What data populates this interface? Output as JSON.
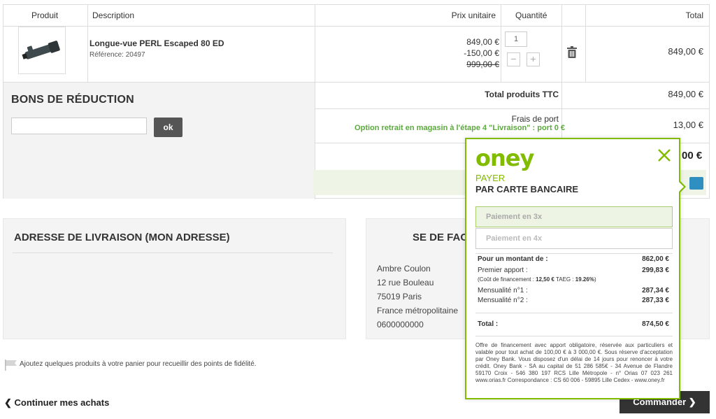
{
  "table": {
    "headers": {
      "produit": "Produit",
      "description": "Description",
      "prix_unitaire": "Prix unitaire",
      "quantite": "Quantité",
      "total": "Total"
    },
    "item": {
      "name": "Longue-vue PERL Escaped 80 ED",
      "reference": "Référence: 20497",
      "price": "849,00 €",
      "discount": "-150,00 €",
      "old_price": "999,00 €",
      "quantity": "1",
      "total": "849,00 €"
    }
  },
  "coupons": {
    "title": "BONS DE RÉDUCTION",
    "input_value": "",
    "ok_label": "ok"
  },
  "totals": {
    "products_label": "Total produits TTC",
    "products_value": "849,00 €",
    "shipping_label": "Frais de port",
    "shipping_note": "Option retrait en magasin à l'étape 4 \"Livraison\" : port 0 €",
    "shipping_value": "13,00 €",
    "grand_total_partial": "00 €"
  },
  "delivery": {
    "title": "ADRESSE DE LIVRAISON (MON ADRESSE)"
  },
  "billing": {
    "title_partial": "SE DE FAC",
    "lines": [
      "Ambre Coulon",
      "12 rue Bouleau",
      "75019 Paris",
      "France métropolitaine",
      "0600000000"
    ]
  },
  "loyalty_text": "Ajoutez quelques produits à votre panier pour recueillir des points de fidélité.",
  "continue_label": "Continuer mes achats",
  "order_label": "Commander",
  "oney": {
    "logo": "oney",
    "payer": "PAYER",
    "par_carte": "PAR CARTE BANCAIRE",
    "options": [
      "Paiement en 3x",
      "Paiement en 4x"
    ],
    "amount_label": "Pour un montant de :",
    "amount_value": "862,00 €",
    "first_label": "Premier apport :",
    "first_value": "299,83 €",
    "cost_note_prefix": "(Coût de financement : ",
    "cost_amount": "12,50 €",
    "cost_taeg_label": " TAEG : ",
    "cost_taeg": "19.26%",
    "cost_note_suffix": ")",
    "m1_label": "Mensualité n°1 :",
    "m1_value": "287,34 €",
    "m2_label": "Mensualité n°2 :",
    "m2_value": "287,33 €",
    "total_label": "Total :",
    "total_value": "874,50 €",
    "fine_print": "Offre de financement avec apport obligatoire, réservée aux particuliers et valable pour tout achat de 100,00 € à 3 000,00 €. Sous réserve d'acceptation par Oney Bank. Vous disposez d'un délai de 14 jours pour renoncer à votre crédit. Oney Bank - SA au capital de 51 286 585€ - 34 Avenue de Flandre 59170 Croix - 546 380 197 RCS Lille Métropole - n° Orias 07 023 261 www.orias.fr Correspondance : CS 60 006 - 59895 Lille Cedex - www.oney.fr"
  },
  "colors": {
    "oney_green": "#81bc00",
    "note_green": "#5aaa3c",
    "button_dark": "#333333"
  }
}
